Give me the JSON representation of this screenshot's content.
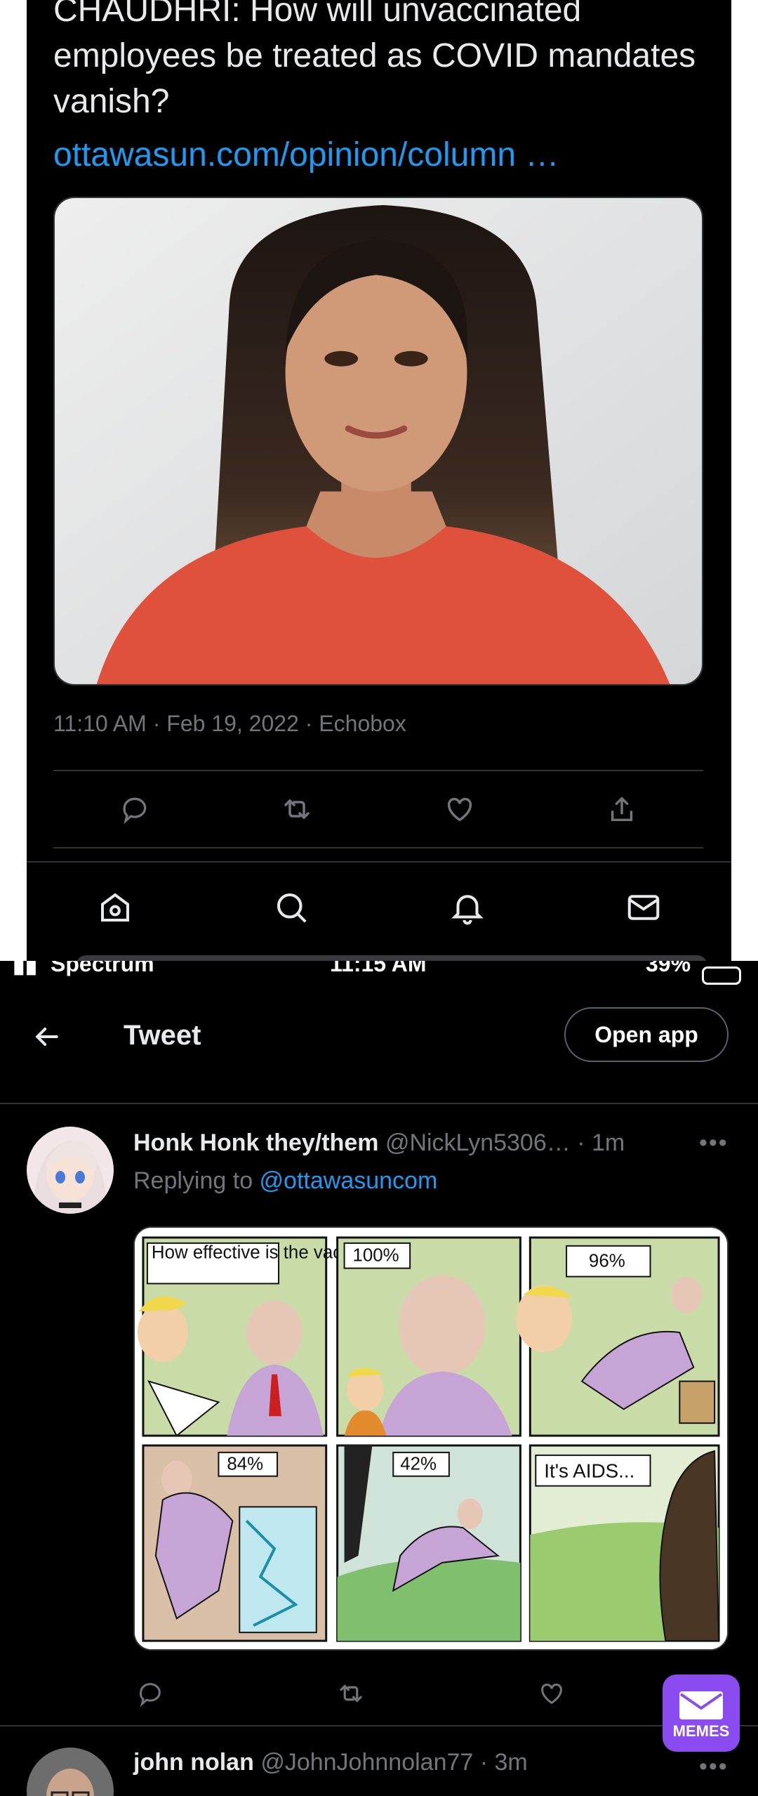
{
  "top_tweet": {
    "text": "CHAUDHRI: How will unvaccinated employees be treated as COVID mandates vanish?",
    "link": "ottawasun.com/opinion/column …",
    "meta": "11:10 AM · Feb 19, 2022 · Echobox",
    "actions": [
      "reply-icon",
      "retweet-icon",
      "like-icon",
      "share-icon"
    ],
    "nav": [
      "home-icon",
      "search-icon",
      "notifications-icon",
      "messages-icon"
    ]
  },
  "status_bar": {
    "carrier": "Spectrum",
    "time": "11:15 AM",
    "battery": "39%"
  },
  "header": {
    "title": "Tweet",
    "open_app": "Open app"
  },
  "reply1": {
    "name": "Honk Honk they/them",
    "handle": "@NickLyn5306…",
    "time": "· 1m",
    "replying_prefix": "Replying to ",
    "mention": "@ottawasuncom",
    "more": "•••",
    "comic_captions": [
      "How effective is the vaccine?",
      "100%",
      "96%",
      "84%",
      "42%",
      "It's AIDS..."
    ]
  },
  "reply2": {
    "name": "john nolan",
    "handle": "@JohnJohnnolan77",
    "time": "· 3m",
    "more": "•••"
  },
  "watermark": {
    "label": "MEMES"
  },
  "colors": {
    "background": "#000000",
    "text": "#e7e9ea",
    "muted": "#71767b",
    "link": "#1d9bf0",
    "divider": "#2f3336",
    "memes_badge": "#8a4cf0"
  }
}
